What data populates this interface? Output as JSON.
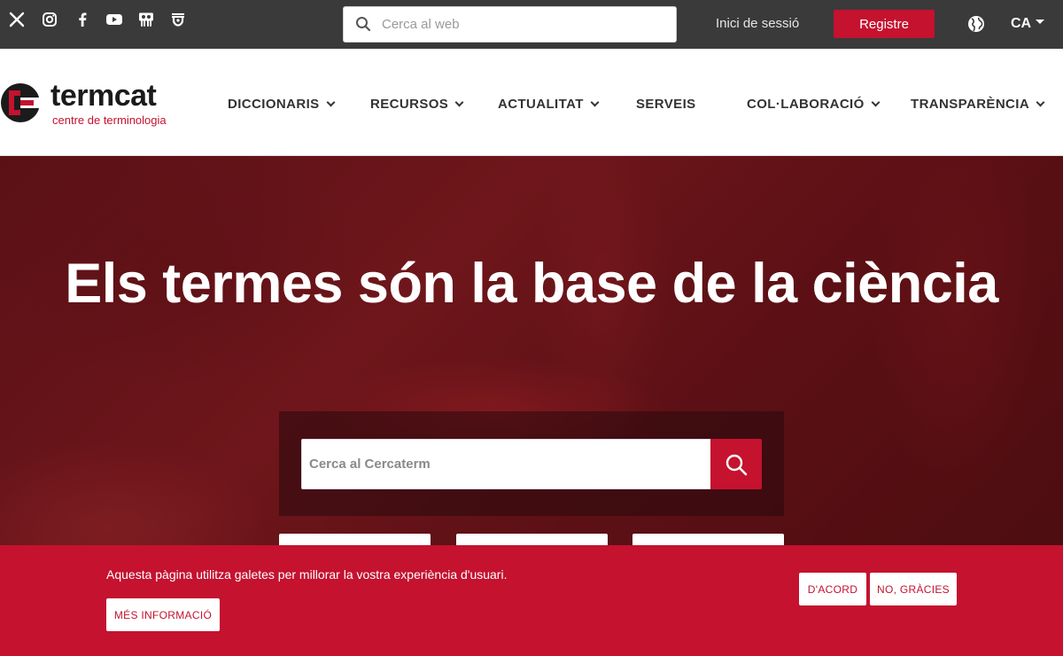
{
  "topbar": {
    "social": [
      {
        "name": "x-icon"
      },
      {
        "name": "instagram-icon"
      },
      {
        "name": "facebook-icon"
      },
      {
        "name": "youtube-icon"
      },
      {
        "name": "slideshare-icon"
      },
      {
        "name": "ivoox-icon"
      }
    ],
    "search_placeholder": "Cerca al web",
    "login_label": "Inici de sessió",
    "register_label": "Registre",
    "language": "CA",
    "bg_color": "#3a3a3a"
  },
  "header": {
    "logo_word": "termcat",
    "logo_sub": "centre de terminologia",
    "nav": [
      {
        "label": "DICCIONARIS",
        "has_dropdown": true
      },
      {
        "label": "RECURSOS",
        "has_dropdown": true
      },
      {
        "label": "ACTUALITAT",
        "has_dropdown": true
      },
      {
        "label": "SERVEIS",
        "has_dropdown": false
      },
      {
        "label": "COL·LABORACIÓ",
        "has_dropdown": true
      },
      {
        "label": "TRANSPARÈNCIA",
        "has_dropdown": true
      }
    ]
  },
  "hero": {
    "title": "Els termes són la base de la ciència",
    "cercaterm_placeholder": "Cerca al Cercaterm"
  },
  "cookie": {
    "text": "Aquesta pàgina utilitza galetes per millorar la vostra experiència d'usuari.",
    "more_label": "MÉS INFORMACIÓ",
    "accept_label": "D'ACORD",
    "decline_label": "NO, GRÀCIES"
  },
  "colors": {
    "brand_red": "#c4122f",
    "topbar": "#3a3a3a",
    "text_dark": "#333333"
  }
}
